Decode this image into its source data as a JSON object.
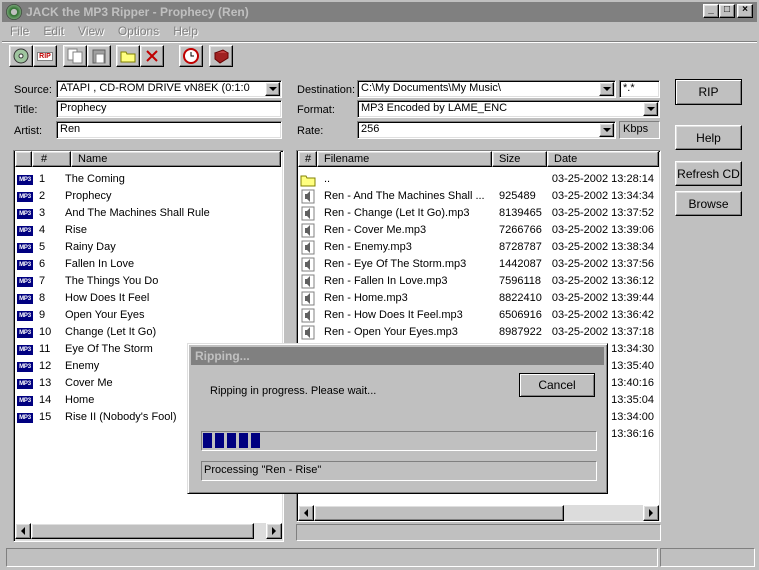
{
  "window": {
    "title": "JACK the MP3 Ripper - Prophecy (Ren)"
  },
  "menu": [
    "File",
    "Edit",
    "View",
    "Options",
    "Help"
  ],
  "toolbar": {
    "rip_label": "RIP"
  },
  "source": {
    "label": "Source:",
    "value": "ATAPI    , CD-ROM DRIVE     vN8EK (0:1:0"
  },
  "title_field": {
    "label": "Title:",
    "value": "Prophecy"
  },
  "artist_field": {
    "label": "Artist:",
    "value": "Ren"
  },
  "destination": {
    "label": "Destination:",
    "value": "C:\\My Documents\\My Music\\",
    "filter": "*.*"
  },
  "format": {
    "label": "Format:",
    "value": "MP3 Encoded by LAME_ENC"
  },
  "rate": {
    "label": "Rate:",
    "value": "256",
    "unit": "Kbps"
  },
  "buttons": {
    "rip": "RIP",
    "help": "Help",
    "refresh": "Refresh CD",
    "browse": "Browse"
  },
  "tracks": {
    "headers": {
      "num": "#",
      "name": "Name"
    },
    "badge": "MP3",
    "items": [
      {
        "n": "1",
        "name": "The Coming"
      },
      {
        "n": "2",
        "name": "Prophecy"
      },
      {
        "n": "3",
        "name": "And The Machines Shall Rule"
      },
      {
        "n": "4",
        "name": "Rise"
      },
      {
        "n": "5",
        "name": "Rainy Day"
      },
      {
        "n": "6",
        "name": "Fallen In Love"
      },
      {
        "n": "7",
        "name": "The Things You Do"
      },
      {
        "n": "8",
        "name": "How Does It Feel"
      },
      {
        "n": "9",
        "name": "Open Your Eyes"
      },
      {
        "n": "10",
        "name": "Change (Let It Go)"
      },
      {
        "n": "11",
        "name": "Eye Of The Storm"
      },
      {
        "n": "12",
        "name": "Enemy"
      },
      {
        "n": "13",
        "name": "Cover Me"
      },
      {
        "n": "14",
        "name": "Home"
      },
      {
        "n": "15",
        "name": "Rise II (Nobody's Fool)"
      }
    ]
  },
  "files": {
    "headers": {
      "num": "#",
      "filename": "Filename",
      "size": "Size",
      "date": "Date"
    },
    "items": [
      {
        "filename": "..",
        "size": "",
        "date": "03-25-2002 13:28:14",
        "type": "folder"
      },
      {
        "filename": "Ren - And The Machines Shall ...",
        "size": "925489",
        "date": "03-25-2002 13:34:34",
        "type": "audio"
      },
      {
        "filename": "Ren - Change (Let It Go).mp3",
        "size": "8139465",
        "date": "03-25-2002 13:37:52",
        "type": "audio"
      },
      {
        "filename": "Ren - Cover Me.mp3",
        "size": "7266766",
        "date": "03-25-2002 13:39:06",
        "type": "audio"
      },
      {
        "filename": "Ren - Enemy.mp3",
        "size": "8728787",
        "date": "03-25-2002 13:38:34",
        "type": "audio"
      },
      {
        "filename": "Ren - Eye Of The Storm.mp3",
        "size": "1442087",
        "date": "03-25-2002 13:37:56",
        "type": "audio"
      },
      {
        "filename": "Ren - Fallen In Love.mp3",
        "size": "7596118",
        "date": "03-25-2002 13:36:12",
        "type": "audio"
      },
      {
        "filename": "Ren - Home.mp3",
        "size": "8822410",
        "date": "03-25-2002 13:39:44",
        "type": "audio"
      },
      {
        "filename": "Ren - How Does It Feel.mp3",
        "size": "6506916",
        "date": "03-25-2002 13:36:42",
        "type": "audio"
      },
      {
        "filename": "Ren - Open Your Eyes.mp3",
        "size": "8987922",
        "date": "03-25-2002 13:37:18",
        "type": "audio"
      },
      {
        "filename": "",
        "size": "",
        "date": "13:34:30",
        "type": "hidden"
      },
      {
        "filename": "",
        "size": "",
        "date": "13:35:40",
        "type": "hidden"
      },
      {
        "filename": "",
        "size": "",
        "date": "13:40:16",
        "type": "hidden"
      },
      {
        "filename": "",
        "size": "",
        "date": "13:35:04",
        "type": "hidden"
      },
      {
        "filename": "",
        "size": "",
        "date": "13:34:00",
        "type": "hidden"
      },
      {
        "filename": "",
        "size": "",
        "date": "13:36:16",
        "type": "hidden"
      }
    ]
  },
  "dialog": {
    "title": "Ripping...",
    "message": "Ripping in progress. Please wait...",
    "cancel": "Cancel",
    "progress_fraction": 0.13,
    "status": "Processing \"Ren - Rise\""
  }
}
